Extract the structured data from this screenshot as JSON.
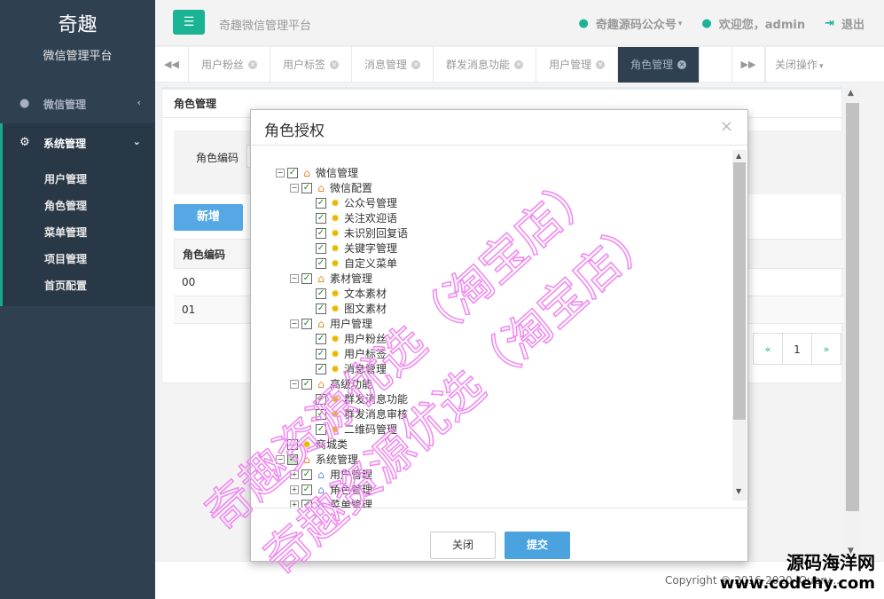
{
  "sidebar": {
    "brand_title": "奇趣",
    "brand_subtitle": "微信管理平台",
    "menu": [
      {
        "label": "微信管理",
        "icon": "wechat-icon"
      },
      {
        "label": "系统管理",
        "icon": "gear-icon"
      }
    ],
    "sub_items": [
      "用户管理",
      "角色管理",
      "菜单管理",
      "项目管理",
      "首页配置"
    ]
  },
  "topbar": {
    "platform_name": "奇趣微信管理平台",
    "wechat_account": "奇趣源码公众号",
    "welcome": "欢迎您，admin",
    "logout": "退出"
  },
  "tabs": [
    {
      "label": "用户粉丝",
      "active": false
    },
    {
      "label": "用户标签",
      "active": false
    },
    {
      "label": "消息管理",
      "active": false
    },
    {
      "label": "群发消息功能",
      "active": false
    },
    {
      "label": "用户管理",
      "active": false
    },
    {
      "label": "角色管理",
      "active": true
    }
  ],
  "tab_ops": "关闭操作",
  "content": {
    "panel_title": "角色管理",
    "search_label": "角色编码",
    "add_button": "新增",
    "table_header": "角色编码",
    "rows": [
      "00",
      "01"
    ],
    "pager": {
      "prev": "«",
      "page": "1",
      "next": "»"
    }
  },
  "footer": {
    "copyright": "Copyright © 2016-2020 jQuery...",
    "site_cn": "源码海洋网",
    "site_url": "www.codehy.com"
  },
  "modal": {
    "title": "角色授权",
    "close_label": "关闭",
    "submit_label": "提交",
    "tree": [
      {
        "label": "微信管理",
        "level": 0,
        "icon": "folder",
        "exp": "minus",
        "checked": "full"
      },
      {
        "label": "微信配置",
        "level": 1,
        "icon": "folder",
        "exp": "minus",
        "checked": "full"
      },
      {
        "label": "公众号管理",
        "level": 2,
        "icon": "leaf",
        "exp": "none",
        "checked": "full"
      },
      {
        "label": "关注欢迎语",
        "level": 2,
        "icon": "leaf",
        "exp": "none",
        "checked": "full"
      },
      {
        "label": "未识别回复语",
        "level": 2,
        "icon": "leaf",
        "exp": "none",
        "checked": "full"
      },
      {
        "label": "关键字管理",
        "level": 2,
        "icon": "leaf",
        "exp": "none",
        "checked": "full"
      },
      {
        "label": "自定义菜单",
        "level": 2,
        "icon": "leaf",
        "exp": "none",
        "checked": "full"
      },
      {
        "label": "素材管理",
        "level": 1,
        "icon": "folder",
        "exp": "minus",
        "checked": "full"
      },
      {
        "label": "文本素材",
        "level": 2,
        "icon": "leaf",
        "exp": "none",
        "checked": "full"
      },
      {
        "label": "图文素材",
        "level": 2,
        "icon": "leaf",
        "exp": "none",
        "checked": "full"
      },
      {
        "label": "用户管理",
        "level": 1,
        "icon": "folder",
        "exp": "minus",
        "checked": "full"
      },
      {
        "label": "用户粉丝",
        "level": 2,
        "icon": "leaf",
        "exp": "none",
        "checked": "full"
      },
      {
        "label": "用户标签",
        "level": 2,
        "icon": "leaf",
        "exp": "none",
        "checked": "full"
      },
      {
        "label": "消息管理",
        "level": 2,
        "icon": "leaf",
        "exp": "none",
        "checked": "full"
      },
      {
        "label": "高级功能",
        "level": 1,
        "icon": "folder",
        "exp": "minus",
        "checked": "full"
      },
      {
        "label": "群发消息功能",
        "level": 2,
        "icon": "leaf",
        "exp": "none",
        "checked": "full"
      },
      {
        "label": "群发消息审核",
        "level": 2,
        "icon": "leaf",
        "exp": "none",
        "checked": "full"
      },
      {
        "label": "二维码管理",
        "level": 2,
        "icon": "leaf",
        "exp": "none",
        "checked": "full"
      },
      {
        "label": "商城类",
        "level": 0,
        "icon": "leaf",
        "exp": "none",
        "checked": "none"
      },
      {
        "label": "系统管理",
        "level": 0,
        "icon": "folder",
        "exp": "minus",
        "checked": "partial"
      },
      {
        "label": "用户管理",
        "level": 1,
        "icon": "blue",
        "exp": "plus",
        "checked": "full"
      },
      {
        "label": "角色管理",
        "level": 1,
        "icon": "blue",
        "exp": "plus",
        "checked": "full"
      },
      {
        "label": "菜单管理",
        "level": 1,
        "icon": "blue",
        "exp": "plus",
        "checked": "full"
      }
    ]
  },
  "watermark": {
    "line1": "奇趣资源优选（淘宝店）",
    "line2": "奇趣资源优选（淘宝店）",
    "color": "#f08cf0"
  },
  "colors": {
    "sidebar_bg": "#2f4050",
    "accent_green": "#1ab394",
    "primary_blue": "#4aa3df"
  }
}
